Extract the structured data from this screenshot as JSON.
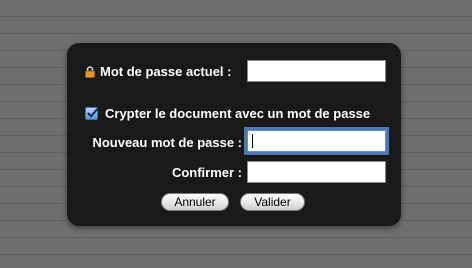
{
  "dialog": {
    "current_password": {
      "label": "Mot de passe actuel :",
      "value": ""
    },
    "encrypt": {
      "label": "Crypter le document avec un mot de passe",
      "checked": true
    },
    "new_password": {
      "label": "Nouveau mot de passe :",
      "value": ""
    },
    "confirm": {
      "label": "Confirmer :",
      "value": ""
    },
    "buttons": {
      "cancel": "Annuler",
      "validate": "Valider"
    }
  },
  "icons": {
    "lock": "lock-icon",
    "check": "checkmark-icon"
  },
  "colors": {
    "panel": "#121212",
    "focus_ring": "#6096e1",
    "checkbox": "#5b95dd"
  }
}
